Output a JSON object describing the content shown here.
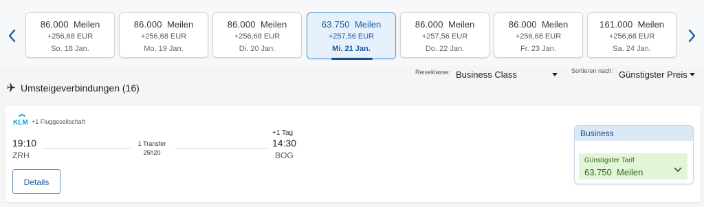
{
  "date_bar": {
    "cards": [
      {
        "miles": "86.000",
        "unit": "Meilen",
        "eur": "+256,68 EUR",
        "date": "So. 18 Jan.",
        "active": false
      },
      {
        "miles": "86.000",
        "unit": "Meilen",
        "eur": "+256,68 EUR",
        "date": "Mo. 19 Jan.",
        "active": false
      },
      {
        "miles": "86.000",
        "unit": "Meilen",
        "eur": "+256,68 EUR",
        "date": "Di. 20 Jan.",
        "active": false
      },
      {
        "miles": "63.750",
        "unit": "Meilen",
        "eur": "+257,56 EUR",
        "date": "Mi. 21 Jan.",
        "active": true
      },
      {
        "miles": "86.000",
        "unit": "Meilen",
        "eur": "+257,56 EUR",
        "date": "Do. 22 Jan.",
        "active": false
      },
      {
        "miles": "86.000",
        "unit": "Meilen",
        "eur": "+256,68 EUR",
        "date": "Fr. 23 Jan.",
        "active": false
      },
      {
        "miles": "161.000",
        "unit": "Meilen",
        "eur": "+256,68 EUR",
        "date": "Sa. 24 Jan.",
        "active": false
      }
    ],
    "prev_icon": "chevron-left-icon",
    "next_icon": "chevron-right-icon"
  },
  "filters": {
    "class_label": "Reiseklasse:",
    "class_value": "Business Class",
    "sort_label": "Sortieren nach:",
    "sort_value": "Günstigster Preis"
  },
  "results": {
    "title": "Umsteigeverbindungen (16)"
  },
  "flight": {
    "airline_extra": "+1 Fluggesellschaft",
    "dep_time": "19:10",
    "dep_airport": "ZRH",
    "transfer": "1 Transfer",
    "duration": "25h20",
    "plus_day": "+1 Tag",
    "arr_time": "14:30",
    "arr_airport": "BOG",
    "details_label": "Details"
  },
  "fare": {
    "cabin": "Business",
    "tariff_label": "Günstigster Tarif",
    "miles": "63.750",
    "unit": "Meilen"
  },
  "colors": {
    "accent": "#1a5aa6",
    "active_card_bg": "#e6f1fb",
    "fare_green_bg": "#e3f4d8",
    "fare_green_text": "#2e6b1a"
  }
}
